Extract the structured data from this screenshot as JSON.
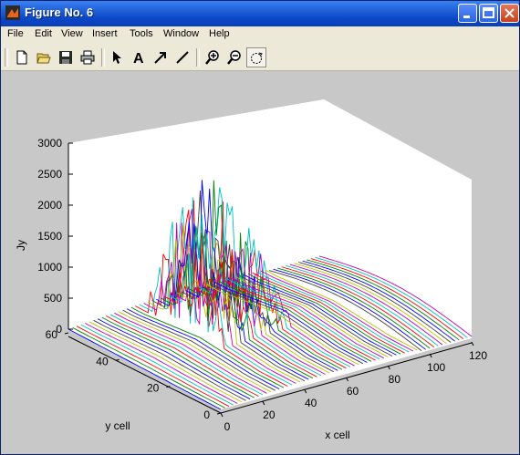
{
  "window": {
    "title": "Figure No. 6"
  },
  "menu": [
    "File",
    "Edit",
    "View",
    "Insert",
    "Tools",
    "Window",
    "Help"
  ],
  "toolbar": [
    "new-file-icon",
    "open-folder-icon",
    "save-icon",
    "print-icon",
    "pointer-arrow-icon",
    "text-icon",
    "arrow-icon",
    "line-icon",
    "zoom-in-icon",
    "zoom-out-icon",
    "rotate-3d-icon"
  ],
  "toolbar_text_glyph": "A",
  "chart_data": {
    "type": "surface-3d",
    "zlabel": "Jy",
    "xlabel": "x cell",
    "ylabel": "y cell",
    "zticks": [
      "0",
      "500",
      "1000",
      "1500",
      "2000",
      "2500",
      "3000"
    ],
    "xticks": [
      "0",
      "20",
      "40",
      "60",
      "80",
      "100",
      "120"
    ],
    "yticks": [
      "0",
      "20",
      "40",
      "60"
    ],
    "xlim": [
      0,
      120
    ],
    "ylim": [
      0,
      60
    ],
    "zlim": [
      0,
      3000
    ]
  }
}
